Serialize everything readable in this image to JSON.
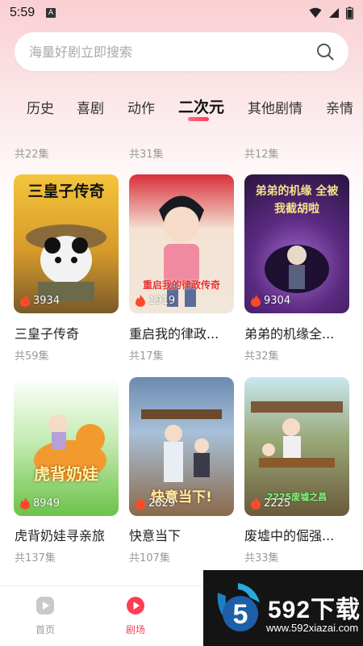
{
  "status_bar": {
    "time": "5:59",
    "app_badge": "A"
  },
  "search": {
    "placeholder": "海量好剧立即搜索"
  },
  "tabs": [
    {
      "label": "历史"
    },
    {
      "label": "喜剧"
    },
    {
      "label": "动作"
    },
    {
      "label": "二次元",
      "active": true
    },
    {
      "label": "其他剧情"
    },
    {
      "label": "亲情"
    }
  ],
  "top_episode_counts": [
    "共22集",
    "共31集",
    "共12集"
  ],
  "dramas": [
    {
      "title": "三皇子传奇",
      "art_text": "三皇子传奇",
      "heat": "3934",
      "episodes": "共59集"
    },
    {
      "title": "重启我的律政...",
      "art_text": "重启我的律政传奇",
      "heat": "1919",
      "episodes": "共17集"
    },
    {
      "title": "弟弟的机缘全...",
      "art_text": "弟弟的机缘 全被我截胡啦",
      "heat": "9304",
      "episodes": "共32集"
    },
    {
      "title": "虎背奶娃寻亲旅",
      "art_text": "虎背奶娃",
      "heat": "8949",
      "episodes": "共137集"
    },
    {
      "title": "快意当下",
      "art_text": "快意当下!",
      "heat": "2829",
      "episodes": "共107集"
    },
    {
      "title": "废墟中的倔强...",
      "art_text": "2225废墟之昌",
      "heat": "2225",
      "episodes": "共33集"
    }
  ],
  "bottom_nav": [
    {
      "label": "首页",
      "active": false
    },
    {
      "label": "剧场",
      "active": true
    }
  ],
  "watermark": {
    "logo_text": "592下载",
    "url": "www.592xiazai.com"
  },
  "colors": {
    "accent": "#ff3d55",
    "muted": "#9a9a9a",
    "top_gradient": "#f9cfd3"
  }
}
